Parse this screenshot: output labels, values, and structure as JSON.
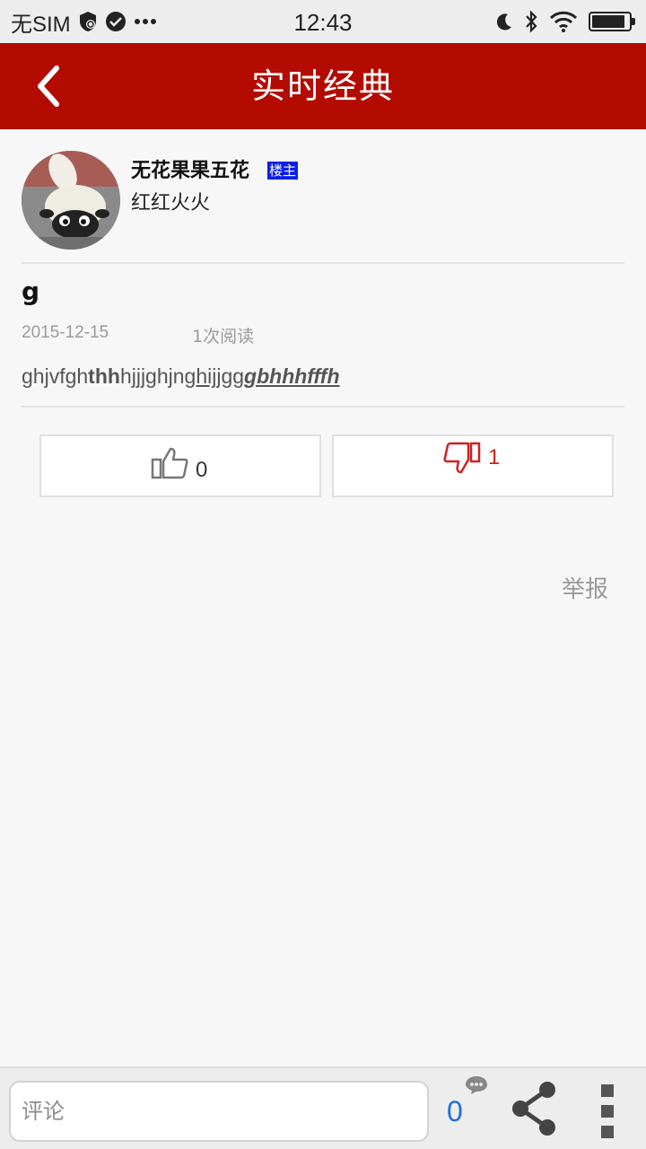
{
  "status_bar": {
    "carrier": "无SIM",
    "time": "12:43",
    "battery_level": 0.9,
    "icons": [
      "shield-icon",
      "check-circle-icon",
      "more-dots-icon",
      "moon-icon",
      "bluetooth-icon",
      "wifi-icon",
      "battery-icon"
    ]
  },
  "header": {
    "title": "实时经典",
    "back_icon": "chevron-left-icon",
    "background_color": "#b30b00"
  },
  "author": {
    "name": "无花果果五花",
    "badge": "楼主",
    "signature": "红红火火"
  },
  "post": {
    "title": "g",
    "date": "2015-12-15",
    "views": "1次阅读",
    "body": {
      "part1": "ghjvfgh",
      "part2_bold": "thh",
      "part3": "hjjjghjn",
      "part4_underline": "ghijjgg",
      "part5_bold_italic": "gbhhhfffh"
    }
  },
  "votes": {
    "like_count": "0",
    "dislike_count": "1",
    "dislike_color": "#cc2222"
  },
  "report_label": "举报",
  "bottom_bar": {
    "comment_placeholder": "评论",
    "comment_count": "0",
    "accent_color": "#1e6fd9"
  }
}
